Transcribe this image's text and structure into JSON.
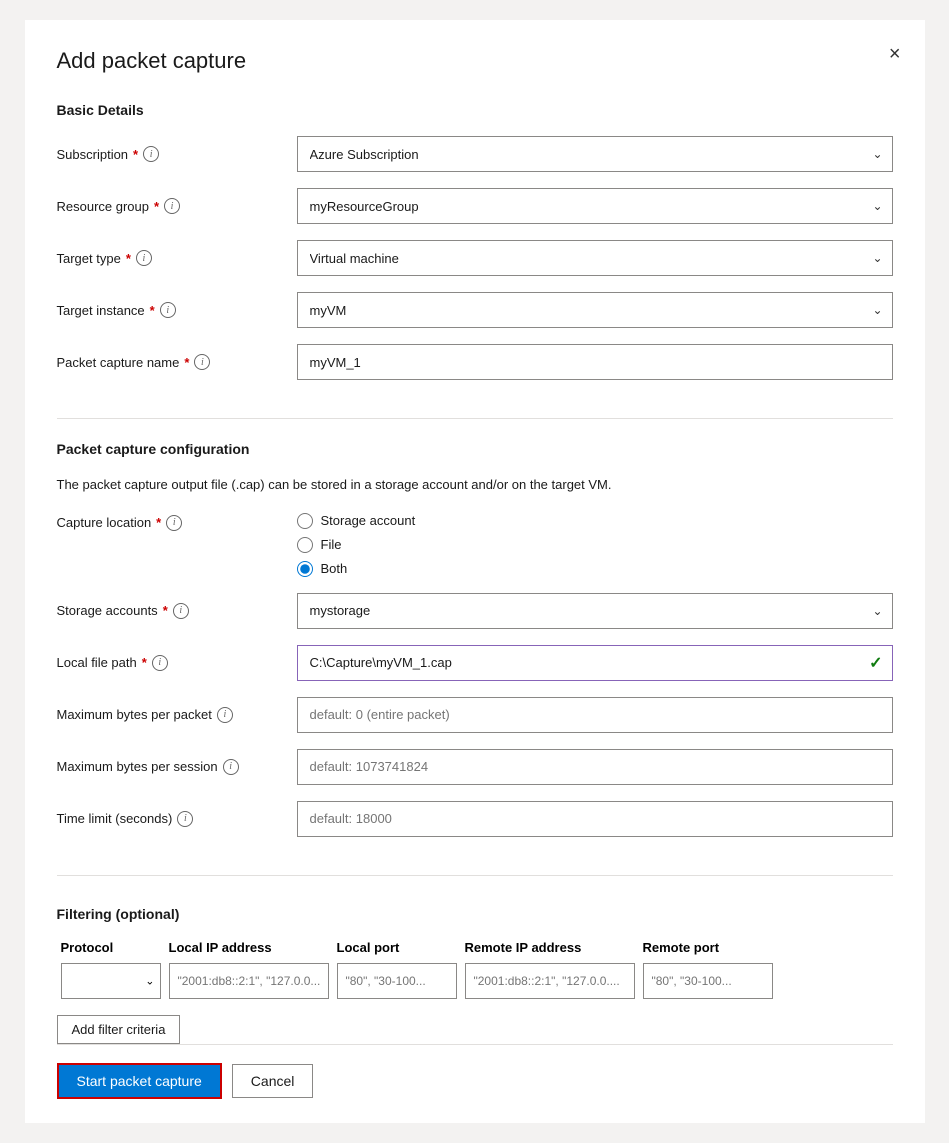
{
  "dialog": {
    "title": "Add packet capture",
    "close_label": "×"
  },
  "sections": {
    "basic_details": {
      "header": "Basic Details",
      "fields": {
        "subscription": {
          "label": "Subscription",
          "required": true,
          "value": "Azure Subscription",
          "options": [
            "Azure Subscription"
          ]
        },
        "resource_group": {
          "label": "Resource group",
          "required": true,
          "value": "myResourceGroup",
          "options": [
            "myResourceGroup"
          ]
        },
        "target_type": {
          "label": "Target type",
          "required": true,
          "value": "Virtual machine",
          "options": [
            "Virtual machine"
          ]
        },
        "target_instance": {
          "label": "Target instance",
          "required": true,
          "value": "myVM",
          "options": [
            "myVM"
          ]
        },
        "packet_capture_name": {
          "label": "Packet capture name",
          "required": true,
          "value": "myVM_1"
        }
      }
    },
    "packet_capture_config": {
      "header": "Packet capture configuration",
      "description": "The packet capture output file (.cap) can be stored in a storage account and/or on the target VM.",
      "capture_location": {
        "label": "Capture location",
        "required": true,
        "options": [
          {
            "label": "Storage account",
            "selected": false
          },
          {
            "label": "File",
            "selected": false
          },
          {
            "label": "Both",
            "selected": true
          }
        ]
      },
      "storage_accounts": {
        "label": "Storage accounts",
        "required": true,
        "value": "mystorage",
        "options": [
          "mystorage"
        ]
      },
      "local_file_path": {
        "label": "Local file path",
        "required": true,
        "value": "C:\\Capture\\myVM_1.cap",
        "has_check": true
      },
      "max_bytes_per_packet": {
        "label": "Maximum bytes per packet",
        "placeholder": "default: 0 (entire packet)"
      },
      "max_bytes_per_session": {
        "label": "Maximum bytes per session",
        "placeholder": "default: 1073741824"
      },
      "time_limit": {
        "label": "Time limit (seconds)",
        "placeholder": "default: 18000"
      }
    },
    "filtering": {
      "header": "Filtering (optional)",
      "columns": [
        "Protocol",
        "Local IP address",
        "Local port",
        "Remote IP address",
        "Remote port"
      ],
      "row": {
        "protocol": "",
        "local_ip": "\"2001:db8::2:1\", \"127.0.0....",
        "local_port": "\"80\", \"30-100...",
        "remote_ip": "\"2001:db8::2:1\", \"127.0.0....",
        "remote_port": "\"80\", \"30-100..."
      },
      "add_filter_label": "Add filter criteria"
    }
  },
  "footer": {
    "start_label": "Start packet capture",
    "cancel_label": "Cancel"
  },
  "icons": {
    "info": "i",
    "chevron_down": "⌄",
    "check": "✓"
  }
}
